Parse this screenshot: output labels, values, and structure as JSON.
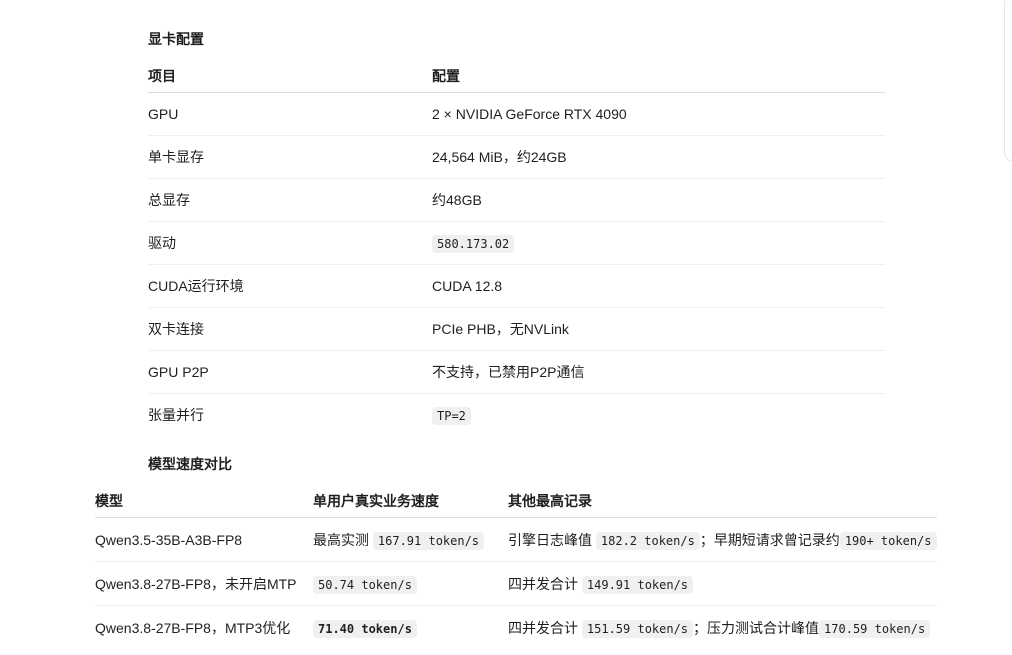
{
  "gpu_section": {
    "title": "显卡配置",
    "headers": [
      "项目",
      "配置"
    ],
    "rows": [
      {
        "item": "GPU",
        "value": "2 × NVIDIA GeForce RTX 4090"
      },
      {
        "item": "单卡显存",
        "value": "24,564 MiB，约24GB"
      },
      {
        "item": "总显存",
        "value": "约48GB"
      },
      {
        "item": "驱动",
        "value": "580.173.02"
      },
      {
        "item": "CUDA运行环境",
        "value": "CUDA 12.8"
      },
      {
        "item": "双卡连接",
        "value": "PCIe PHB，无NVLink"
      },
      {
        "item": "GPU P2P",
        "value": "不支持，已禁用P2P通信"
      },
      {
        "item": "张量并行",
        "value": "TP=2"
      }
    ]
  },
  "model_section": {
    "title": "模型速度对比",
    "headers": [
      "模型",
      "单用户真实业务速度",
      "其他最高记录"
    ],
    "rows": [
      {
        "model": "Qwen3.5-35B-A3B-FP8",
        "speed_prefix": "最高实测",
        "speed_code": "167.91 token/s",
        "other_a_text": "引擎日志峰值",
        "other_a_code": "182.2 token/s",
        "other_sep": "；",
        "other_b_text": "早期短请求曾记录约",
        "other_b_code": "190+ token/s"
      },
      {
        "model": "Qwen3.8-27B-FP8，未开启MTP",
        "speed_code": "50.74 token/s",
        "other_a_text": "四并发合计",
        "other_a_code": "149.91 token/s"
      },
      {
        "model": "Qwen3.8-27B-FP8，MTP3优化",
        "speed_code": "71.40 token/s",
        "other_a_text": "四并发合计",
        "other_a_code": "151.59 token/s",
        "other_sep": "；",
        "other_b_text": "压力测试合计峰值",
        "other_b_code": "170.59 token/s"
      }
    ]
  }
}
